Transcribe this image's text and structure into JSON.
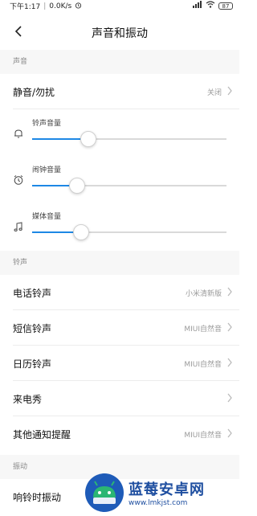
{
  "status_bar": {
    "time": "下午1:17",
    "speed": "0.0K/s",
    "battery": "87"
  },
  "header": {
    "title": "声音和振动"
  },
  "sections": {
    "sound": "声音",
    "ringtone": "铃声",
    "vibration": "振动"
  },
  "dnd": {
    "label": "静音/勿扰",
    "value": "关闭"
  },
  "sliders": {
    "ringer": {
      "label": "铃声音量",
      "level": 0.29,
      "icon": "bell-icon"
    },
    "alarm": {
      "label": "闹钟音量",
      "level": 0.23,
      "icon": "alarm-clock-icon"
    },
    "media": {
      "label": "媒体音量",
      "level": 0.25,
      "icon": "music-note-icon"
    }
  },
  "ringtone_rows": [
    {
      "label": "电话铃声",
      "value": "小米清新版"
    },
    {
      "label": "短信铃声",
      "value": "MIUI自然音"
    },
    {
      "label": "日历铃声",
      "value": "MIUI自然音"
    },
    {
      "label": "来电秀",
      "value": ""
    },
    {
      "label": "其他通知提醒",
      "value": "MIUI自然音"
    }
  ],
  "vibration_rows": [
    {
      "label": "响铃时振动"
    }
  ],
  "watermark": {
    "text": "蓝莓安卓网",
    "url": "www.lmkjst.com"
  },
  "colors": {
    "accent": "#1e88e5",
    "section_bg": "#f7f7f7",
    "secondary_text": "#9a9a9a"
  }
}
